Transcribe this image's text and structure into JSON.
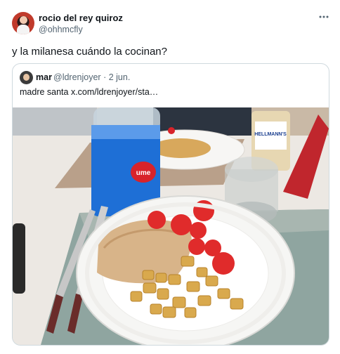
{
  "tweet": {
    "author": {
      "display_name": "rocio del rey quiroz",
      "handle": "@ohhmcfly",
      "avatar_icon": "avatar-photo"
    },
    "text": "y la milanesa cuándo la cocinan?",
    "more_icon": "more-horizontal-icon"
  },
  "quoted_tweet": {
    "author": {
      "display_name": "mar",
      "handle": "@ldrenjoyer",
      "separator": "·",
      "date": "2 jun."
    },
    "text": "madre santa  x.com/ldrenjoyer/sta…",
    "image": {
      "bottle_label": "ume",
      "mayo_label": "HELLMANN'S"
    }
  },
  "colors": {
    "text_primary": "#0f1419",
    "text_secondary": "#536471",
    "border": "#cfd9de"
  }
}
